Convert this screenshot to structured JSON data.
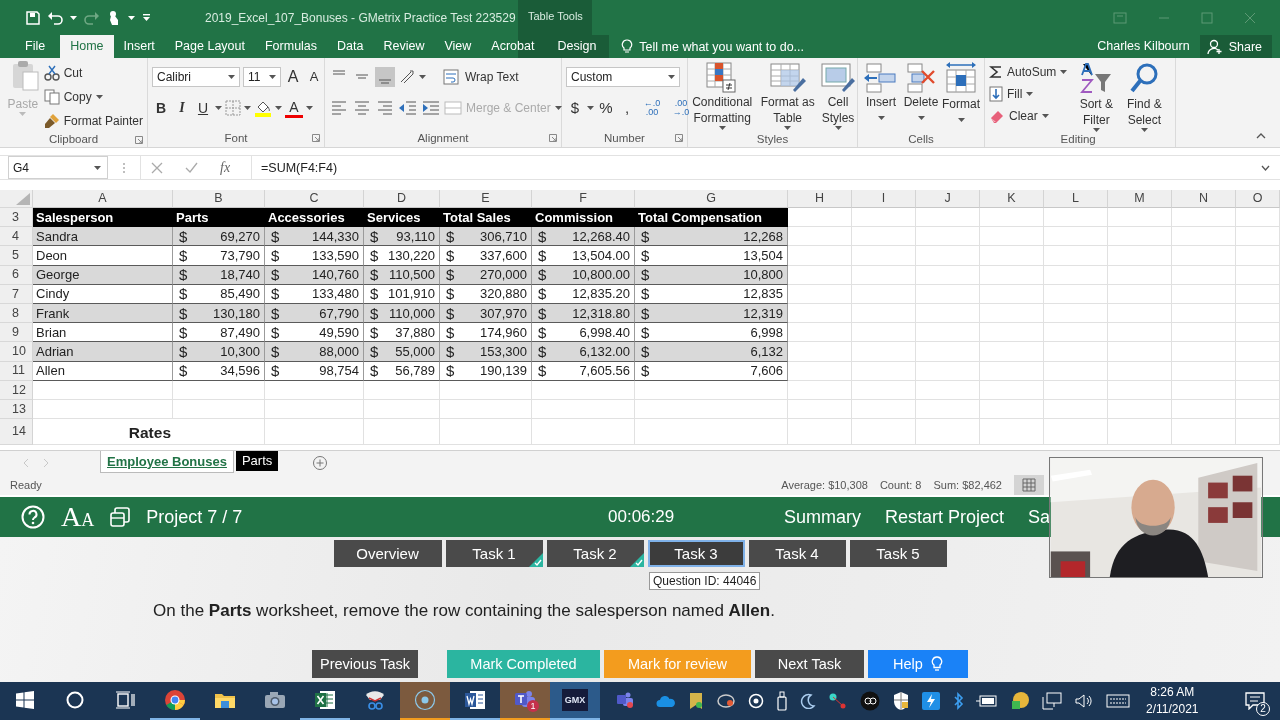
{
  "title_bar": {
    "title": "2019_Excel_107_Bonuses - GMetrix Practice Test 223529",
    "context_group": "Table Tools"
  },
  "ribbon_tabs": [
    {
      "label": "File",
      "selected": false,
      "contextual": false
    },
    {
      "label": "Home",
      "selected": true,
      "contextual": false
    },
    {
      "label": "Insert",
      "selected": false,
      "contextual": false
    },
    {
      "label": "Page Layout",
      "selected": false,
      "contextual": false
    },
    {
      "label": "Formulas",
      "selected": false,
      "contextual": false
    },
    {
      "label": "Data",
      "selected": false,
      "contextual": false
    },
    {
      "label": "Review",
      "selected": false,
      "contextual": false
    },
    {
      "label": "View",
      "selected": false,
      "contextual": false
    },
    {
      "label": "Acrobat",
      "selected": false,
      "contextual": false
    },
    {
      "label": "Design",
      "selected": false,
      "contextual": true
    }
  ],
  "tell_me": {
    "placeholder": "Tell me what you want to do..."
  },
  "user": "Charles Kilbourn",
  "share_button": "Share",
  "ribbon_groups": [
    {
      "kind": "clipboard",
      "label": "Clipboard",
      "items": [
        {
          "label": "Paste",
          "disabled": true
        },
        {
          "label": "Cut",
          "disabled": false
        },
        {
          "label": "Copy",
          "disabled": false
        },
        {
          "label": "Format Painter",
          "disabled": false
        }
      ]
    },
    {
      "kind": "font",
      "label": "Font",
      "font_name": "Calibri",
      "font_size": "11",
      "size_buttons": [
        "A",
        "A"
      ],
      "format_buttons": [
        "B",
        "I",
        "U"
      ],
      "font_color": "A"
    },
    {
      "kind": "alignment",
      "label": "Alignment",
      "vertical_align": [
        {
          "selected": false
        },
        {
          "selected": false
        },
        {
          "selected": true
        }
      ],
      "wrap_text": "Wrap Text",
      "merge": {
        "label": "Merge & Center",
        "disabled": true
      }
    },
    {
      "kind": "number",
      "label": "Number",
      "format": "Custom",
      "symbols": [
        "$",
        "%",
        ","
      ],
      "decimal_buttons": [
        {
          "top": "←.0",
          "bottom": ".00"
        },
        {
          "top": ".00",
          "bottom": "→.0"
        }
      ]
    },
    {
      "kind": "styles",
      "label": "Styles",
      "buttons": [
        "Conditional Formatting",
        "Format as Table",
        "Cell Styles"
      ]
    },
    {
      "kind": "cells",
      "label": "Cells",
      "buttons": [
        "Insert",
        "Delete",
        "Format"
      ]
    },
    {
      "kind": "editing",
      "label": "Editing",
      "small": [
        "AutoSum",
        "Fill",
        "Clear"
      ],
      "buttons": [
        "Sort & Filter",
        "Find & Select"
      ]
    }
  ],
  "formula_bar": {
    "name_box": "G4",
    "function_label": "fx",
    "formula": "=SUM(F4:F4)"
  },
  "columns": [
    "A",
    "B",
    "C",
    "D",
    "E",
    "F",
    "G",
    "H",
    "I",
    "J",
    "K",
    "L",
    "M",
    "N",
    "O"
  ],
  "rows": [
    {
      "header": "3",
      "kind": "header",
      "cells": [
        {
          "value": "Salesperson"
        },
        {
          "value": "Parts"
        },
        {
          "value": "Accessories"
        },
        {
          "value": "Services"
        },
        {
          "value": "Total Sales"
        },
        {
          "value": "Commission"
        },
        {
          "value": "Total Compensation"
        }
      ]
    },
    {
      "header": "4",
      "kind": "data",
      "shaded": true,
      "cells": [
        {
          "value": "Sandra"
        },
        {
          "symbol": "$",
          "value": "69,270"
        },
        {
          "symbol": "$",
          "value": "144,330"
        },
        {
          "symbol": "$",
          "value": "93,110"
        },
        {
          "symbol": "$",
          "value": "306,710"
        },
        {
          "symbol": "$",
          "value": "12,268.40"
        },
        {
          "symbol": "$",
          "value": "12,268"
        }
      ]
    },
    {
      "header": "5",
      "kind": "data",
      "shaded": false,
      "cells": [
        {
          "value": "Deon"
        },
        {
          "symbol": "$",
          "value": "73,790"
        },
        {
          "symbol": "$",
          "value": "133,590"
        },
        {
          "symbol": "$",
          "value": "130,220"
        },
        {
          "symbol": "$",
          "value": "337,600"
        },
        {
          "symbol": "$",
          "value": "13,504.00"
        },
        {
          "symbol": "$",
          "value": "13,504"
        }
      ]
    },
    {
      "header": "6",
      "kind": "data",
      "shaded": true,
      "cells": [
        {
          "value": "George"
        },
        {
          "symbol": "$",
          "value": "18,740"
        },
        {
          "symbol": "$",
          "value": "140,760"
        },
        {
          "symbol": "$",
          "value": "110,500"
        },
        {
          "symbol": "$",
          "value": "270,000"
        },
        {
          "symbol": "$",
          "value": "10,800.00"
        },
        {
          "symbol": "$",
          "value": "10,800"
        }
      ]
    },
    {
      "header": "7",
      "kind": "data",
      "shaded": false,
      "cells": [
        {
          "value": "Cindy"
        },
        {
          "symbol": "$",
          "value": "85,490"
        },
        {
          "symbol": "$",
          "value": "133,480"
        },
        {
          "symbol": "$",
          "value": "101,910"
        },
        {
          "symbol": "$",
          "value": "320,880"
        },
        {
          "symbol": "$",
          "value": "12,835.20"
        },
        {
          "symbol": "$",
          "value": "12,835"
        }
      ]
    },
    {
      "header": "8",
      "kind": "data",
      "shaded": true,
      "cells": [
        {
          "value": "Frank"
        },
        {
          "symbol": "$",
          "value": "130,180"
        },
        {
          "symbol": "$",
          "value": "67,790"
        },
        {
          "symbol": "$",
          "value": "110,000"
        },
        {
          "symbol": "$",
          "value": "307,970"
        },
        {
          "symbol": "$",
          "value": "12,318.80"
        },
        {
          "symbol": "$",
          "value": "12,319"
        }
      ]
    },
    {
      "header": "9",
      "kind": "data",
      "shaded": false,
      "cells": [
        {
          "value": "Brian"
        },
        {
          "symbol": "$",
          "value": "87,490"
        },
        {
          "symbol": "$",
          "value": "49,590"
        },
        {
          "symbol": "$",
          "value": "37,880"
        },
        {
          "symbol": "$",
          "value": "174,960"
        },
        {
          "symbol": "$",
          "value": "6,998.40"
        },
        {
          "symbol": "$",
          "value": "6,998"
        }
      ]
    },
    {
      "header": "10",
      "kind": "data",
      "shaded": true,
      "cells": [
        {
          "value": "Adrian"
        },
        {
          "symbol": "$",
          "value": "10,300"
        },
        {
          "symbol": "$",
          "value": "88,000"
        },
        {
          "symbol": "$",
          "value": "55,000"
        },
        {
          "symbol": "$",
          "value": "153,300"
        },
        {
          "symbol": "$",
          "value": "6,132.00"
        },
        {
          "symbol": "$",
          "value": "6,132"
        }
      ]
    },
    {
      "header": "11",
      "kind": "data",
      "shaded": false,
      "cells": [
        {
          "value": "Allen"
        },
        {
          "symbol": "$",
          "value": "34,596"
        },
        {
          "symbol": "$",
          "value": "98,754"
        },
        {
          "symbol": "$",
          "value": "56,789"
        },
        {
          "symbol": "$",
          "value": "190,139"
        },
        {
          "symbol": "$",
          "value": "7,605.56"
        },
        {
          "symbol": "$",
          "value": "7,606"
        }
      ]
    },
    {
      "header": "12",
      "kind": "empty"
    },
    {
      "header": "13",
      "kind": "empty"
    },
    {
      "header": "14",
      "kind": "title",
      "cells": [
        {
          "value": "Rates"
        }
      ]
    }
  ],
  "sheet_tabs": [
    {
      "label": "Employee Bonuses",
      "selected": true
    },
    {
      "label": "Parts",
      "selected": false,
      "color": "#000000"
    }
  ],
  "status_bar": {
    "mode": "Ready",
    "stats": [
      "Average: $10,308",
      "Count: 8",
      "Sum: $82,462"
    ]
  },
  "test_bar": {
    "font_button": [
      "A",
      "A"
    ],
    "project": "Project 7 / 7",
    "timer": "00:06:29",
    "links": [
      "Summary",
      "Restart Project",
      "Sa"
    ]
  },
  "task_tabs": [
    {
      "label": "Overview",
      "selected": false,
      "completed": false
    },
    {
      "label": "Task 1",
      "selected": false,
      "completed": true
    },
    {
      "label": "Task 2",
      "selected": false,
      "completed": true
    },
    {
      "label": "Task 3",
      "selected": true,
      "completed": false
    },
    {
      "label": "Task 4",
      "selected": false,
      "completed": false
    },
    {
      "label": "Task 5",
      "selected": false,
      "completed": false
    }
  ],
  "tooltip": "Question ID: 44046",
  "instruction": "On the **Parts** worksheet, remove the row containing the salesperson named **Allen**.",
  "task_buttons": [
    {
      "label": "Previous Task",
      "kind": "dark"
    },
    {
      "label": "Mark Completed",
      "kind": "teal"
    },
    {
      "label": "Mark for review",
      "kind": "orange"
    },
    {
      "label": "Next Task",
      "kind": "dark"
    },
    {
      "label": "Help",
      "kind": "help"
    }
  ],
  "taskbar": {
    "apps": [
      {
        "running": false,
        "highlighted": false,
        "selected": false
      },
      {
        "running": false,
        "highlighted": false,
        "selected": false
      },
      {
        "running": false,
        "highlighted": false,
        "selected": false
      },
      {
        "running": true,
        "highlighted": false,
        "selected": false
      },
      {
        "running": false,
        "highlighted": false,
        "selected": false
      },
      {
        "running": false,
        "highlighted": false,
        "selected": false
      },
      {
        "running": true,
        "highlighted": false,
        "selected": false
      },
      {
        "running": false,
        "highlighted": false,
        "selected": false
      },
      {
        "running": true,
        "highlighted": true,
        "selected": false
      },
      {
        "running": true,
        "highlighted": false,
        "selected": false
      },
      {
        "running": true,
        "highlighted": true,
        "selected": false,
        "badge": "1"
      },
      {
        "running": true,
        "highlighted": false,
        "selected": true,
        "label": "GMX"
      },
      {
        "running": false,
        "highlighted": false,
        "selected": false
      }
    ],
    "clock": {
      "time": "8:26 AM",
      "date": "2/11/2021"
    },
    "notifications": "2"
  }
}
